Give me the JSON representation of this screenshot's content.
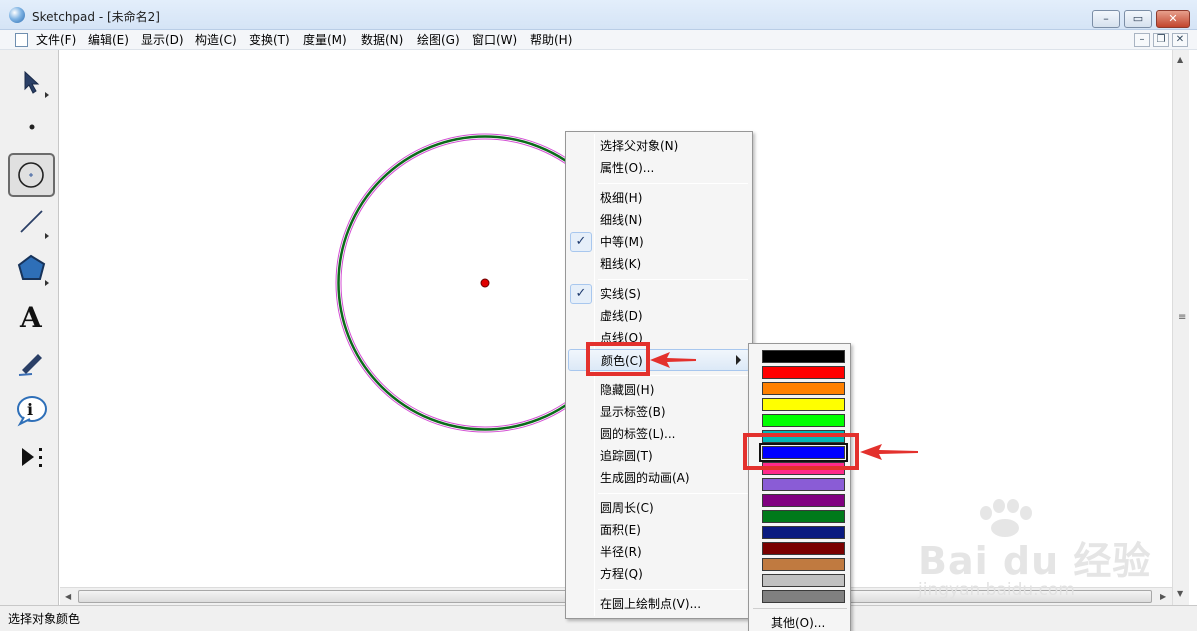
{
  "window": {
    "app_name": "Sketchpad",
    "doc_title": " - [未命名2]",
    "min_glyph": "–",
    "max_glyph": "▭",
    "close_glyph": "✕"
  },
  "menubar": {
    "items": [
      "文件(F)",
      "编辑(E)",
      "显示(D)",
      "构造(C)",
      "变换(T)",
      "度量(M)",
      "数据(N)",
      "绘图(G)",
      "窗口(W)",
      "帮助(H)"
    ],
    "mdi_min": "–",
    "mdi_restore": "❐",
    "mdi_close": "✕"
  },
  "toolbox": {
    "tools": [
      "arrow-tool-icon",
      "point-tool-icon",
      "compass-tool-icon",
      "straightedge-tool-icon",
      "polygon-tool-icon",
      "text-tool-icon",
      "marker-tool-icon",
      "information-tool-icon",
      "custom-tool-icon"
    ],
    "text_tool_glyph": "A",
    "info_tool_glyph": "i",
    "active_tool": "compass-tool-icon"
  },
  "context_menu": {
    "groups": [
      [
        {
          "label": "选择父对象(N)"
        },
        {
          "label": "属性(O)..."
        }
      ],
      [
        {
          "label": "极细(H)"
        },
        {
          "label": "细线(N)"
        },
        {
          "label": "中等(M)",
          "checked": true
        },
        {
          "label": "粗线(K)"
        }
      ],
      [
        {
          "label": "实线(S)",
          "checked": true
        },
        {
          "label": "虚线(D)"
        },
        {
          "label": "点线(O)"
        },
        {
          "label": "颜色(C)",
          "submenu": true,
          "highlighted": true
        }
      ],
      [
        {
          "label": "隐藏圆(H)"
        },
        {
          "label": "显示标签(B)"
        },
        {
          "label": "圆的标签(L)..."
        },
        {
          "label": "追踪圆(T)"
        },
        {
          "label": "生成圆的动画(A)"
        }
      ],
      [
        {
          "label": "圆周长(C)"
        },
        {
          "label": "面积(E)"
        },
        {
          "label": "半径(R)"
        },
        {
          "label": "方程(Q)"
        }
      ],
      [
        {
          "label": "在圆上绘制点(V)..."
        }
      ]
    ],
    "check_glyph": "✓"
  },
  "color_menu": {
    "swatches": [
      "#000000",
      "#ff0000",
      "#ff8000",
      "#ffff00",
      "#00ff00",
      "#00b8b8",
      "#0000ff",
      "#ff2a8a",
      "#8a5cd6",
      "#800080",
      "#007a1a",
      "#0a1a80",
      "#7a0000",
      "#c07a40",
      "#c0c0c0",
      "#808080"
    ],
    "selected_index": 6,
    "other_label": "其他(O)..."
  },
  "status": {
    "text": "选择对象颜色"
  },
  "watermark": {
    "logo": "Bai du 经验",
    "url": "jingyan.baidu.com"
  },
  "colors": {
    "annotation": "#e3312d",
    "circle_stroke": "#0b6b1a",
    "circle_highlight": "#d450d4",
    "center_point": "#e00000"
  }
}
